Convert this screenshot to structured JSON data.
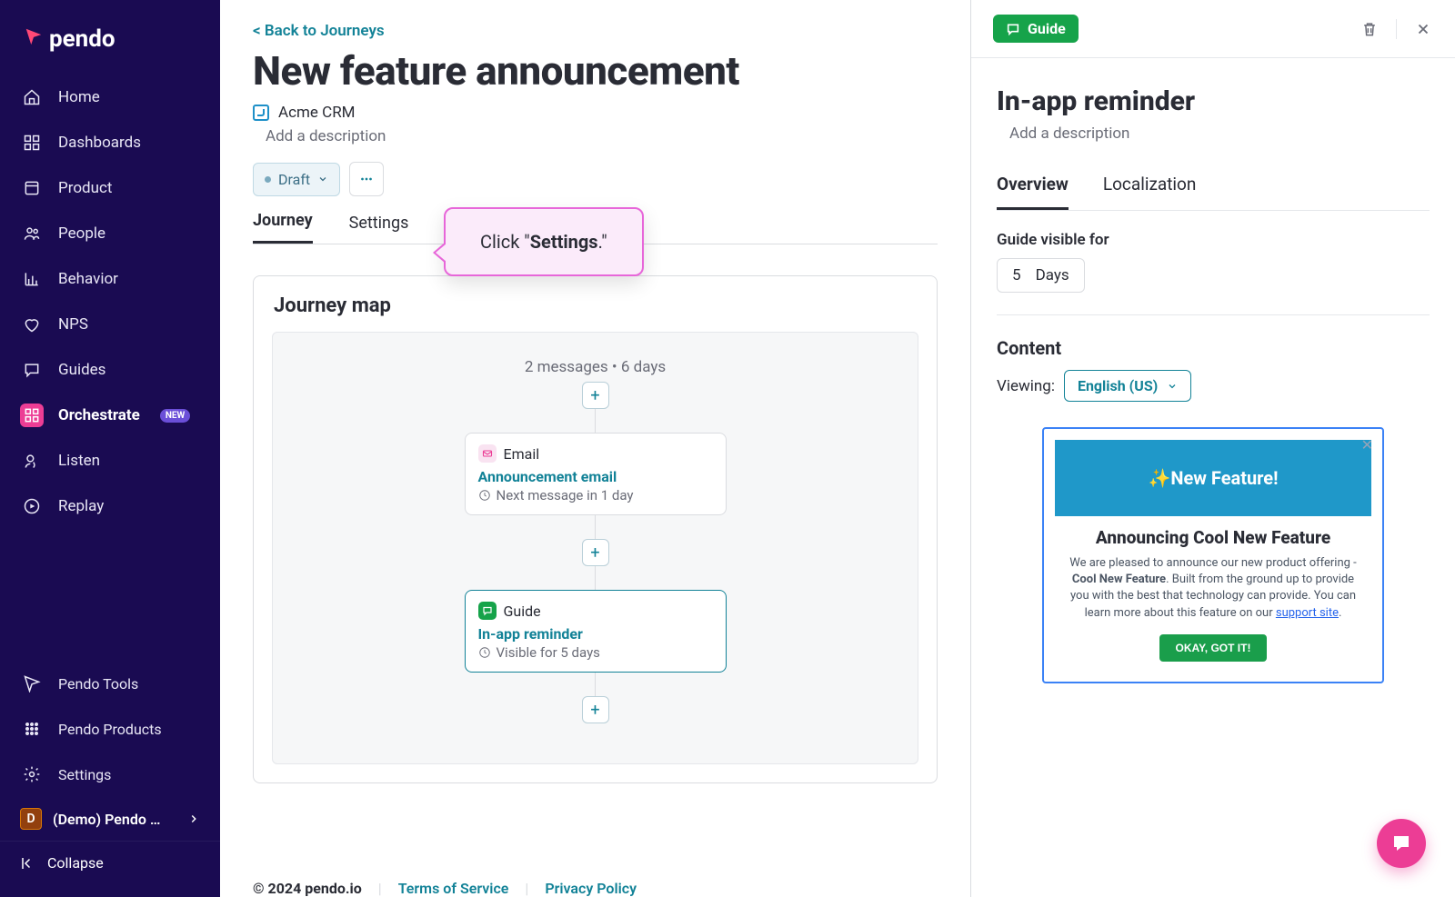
{
  "brand": "pendo",
  "sidebar": {
    "items": [
      {
        "label": "Home"
      },
      {
        "label": "Dashboards"
      },
      {
        "label": "Product"
      },
      {
        "label": "People"
      },
      {
        "label": "Behavior"
      },
      {
        "label": "NPS"
      },
      {
        "label": "Guides"
      },
      {
        "label": "Orchestrate",
        "badge": "NEW"
      },
      {
        "label": "Listen"
      },
      {
        "label": "Replay"
      }
    ],
    "bottom": [
      {
        "label": "Pendo Tools"
      },
      {
        "label": "Pendo Products"
      },
      {
        "label": "Settings"
      }
    ],
    "account": "(Demo) Pendo …",
    "account_initial": "D",
    "collapse": "Collapse"
  },
  "main": {
    "back": "< Back to Journeys",
    "title": "New feature announcement",
    "app": "Acme CRM",
    "description_placeholder": "Add a description",
    "status": "Draft",
    "tabs": [
      "Journey",
      "Settings"
    ],
    "active_tab": 0,
    "callout_prefix": "Click \"",
    "callout_bold": "Settings",
    "callout_suffix": ".\"",
    "journey": {
      "title": "Journey map",
      "summary": "2 messages • 6 days",
      "nodes": [
        {
          "type": "Email",
          "title": "Announcement email",
          "sub": "Next message in 1 day"
        },
        {
          "type": "Guide",
          "title": "In-app reminder",
          "sub": "Visible for 5 days"
        }
      ]
    }
  },
  "footer": {
    "copyright": "© 2024 pendo.io",
    "tos": "Terms of Service",
    "privacy": "Privacy Policy"
  },
  "panel": {
    "chip": "Guide",
    "title": "In-app reminder",
    "description_placeholder": "Add a description",
    "tabs": [
      "Overview",
      "Localization"
    ],
    "active_tab": 0,
    "visible_label": "Guide visible for",
    "visible_value": "5",
    "visible_unit": "Days",
    "content_label": "Content",
    "viewing_label": "Viewing:",
    "language": "English (US)",
    "preview": {
      "hero": "✨New Feature!",
      "heading": "Announcing Cool New Feature",
      "body_1": "We are pleased to announce our new product offering - ",
      "body_bold": "Cool New Feature",
      "body_2": ". Built from the ground up to provide you with the best that technology can provide. You can learn more about this feature on our ",
      "link": "support site",
      "body_3": ".",
      "button": "OKAY, GOT IT!"
    }
  }
}
